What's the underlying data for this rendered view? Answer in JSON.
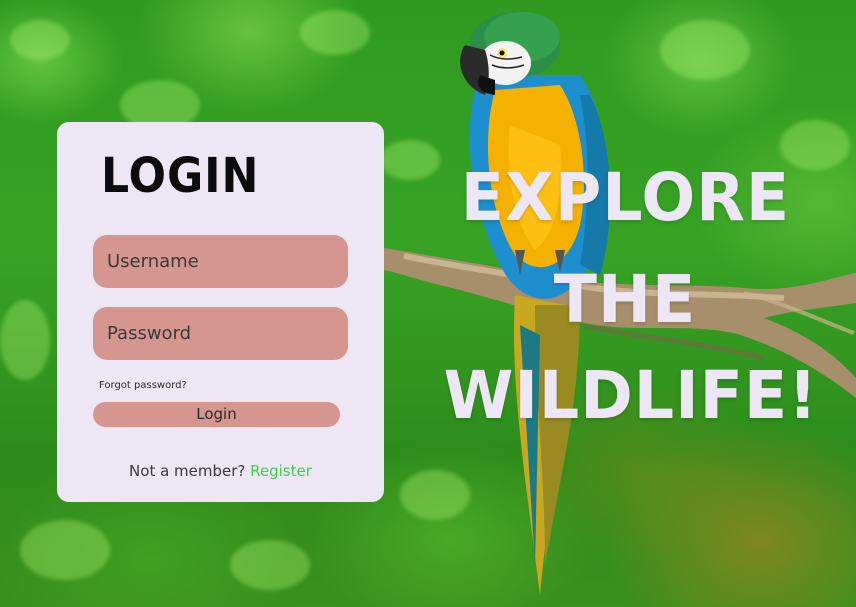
{
  "login": {
    "title": "LOGIN",
    "username_placeholder": "Username",
    "password_placeholder": "Password",
    "forgot_label": "Forgot password?",
    "submit_label": "Login",
    "register_prompt": "Not a member?",
    "register_label": "Register"
  },
  "hero": {
    "line1": "EXPLORE",
    "line2": "THE",
    "line3": "WILDLIFE!"
  },
  "colors": {
    "card_bg": "#ece6f5",
    "field_bg": "#d69690",
    "register_link": "#3fcf4a",
    "headline": "#ece6f5"
  }
}
